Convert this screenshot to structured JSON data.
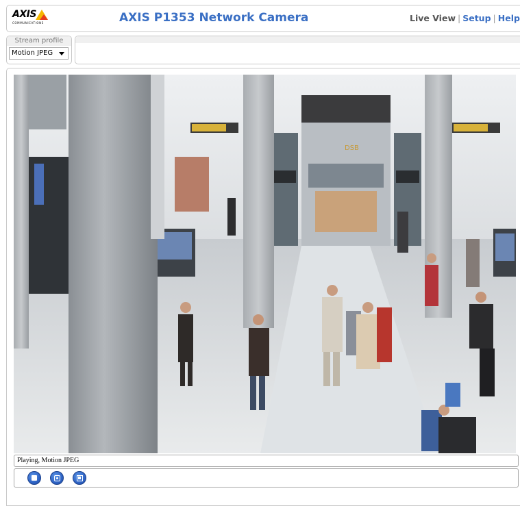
{
  "header": {
    "logo_text": "AXIS",
    "logo_sub": "COMMUNICATIONS",
    "product_title": "AXIS P1353 Network Camera",
    "nav": {
      "live_view": "Live View",
      "separator": "|",
      "setup": "Setup",
      "help": "Help"
    }
  },
  "stream_profile": {
    "label": "Stream profile",
    "selected": "Motion JPEG"
  },
  "viewer": {
    "status_text": "Playing, Motion JPEG"
  },
  "controls": {
    "stop_icon": "stop-icon",
    "snapshot_icon": "snapshot-icon",
    "fullscreen_icon": "fullscreen-icon"
  },
  "colors": {
    "accent": "#3a6fc4",
    "button": "#2e63c5",
    "logo_yellow": "#f5b800",
    "logo_red": "#e63c1f"
  }
}
